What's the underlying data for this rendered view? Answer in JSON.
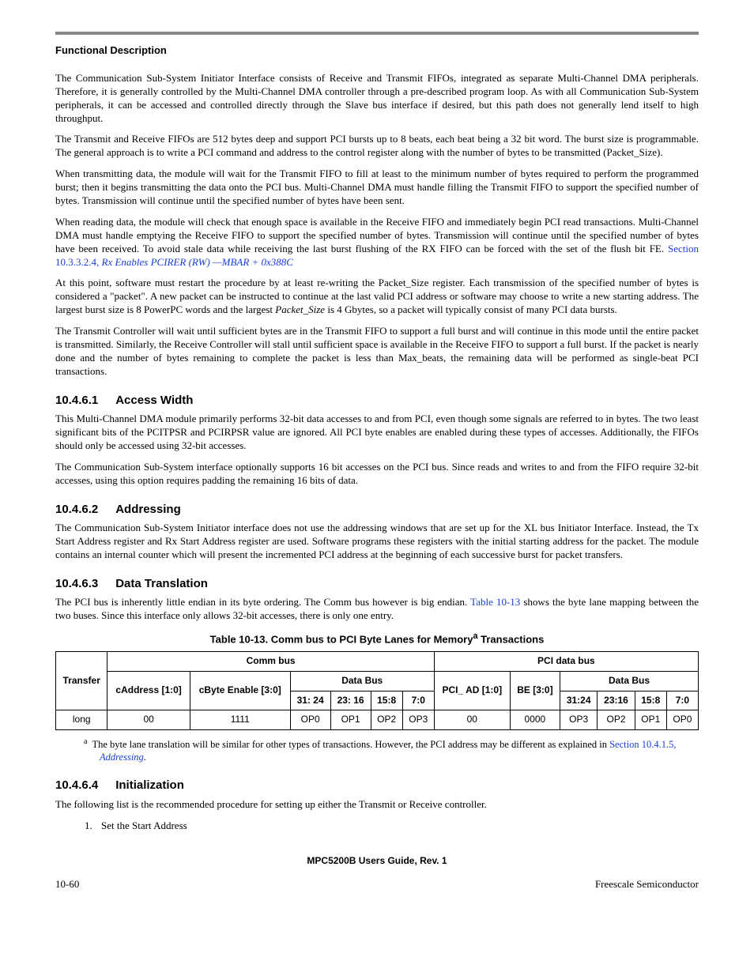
{
  "header": {
    "section_label": "Functional Description"
  },
  "chart_data": {
    "type": "table",
    "title": "Comm bus to PCI Byte Lanes for Memory Transactions",
    "groups": [
      "Transfer",
      "Comm bus",
      "PCI data bus"
    ],
    "columns": [
      "Transfer",
      "cAddress [1:0]",
      "cByte Enable [3:0]",
      "Data Bus 31:24",
      "Data Bus 23:16",
      "Data Bus 15:8",
      "Data Bus 7:0",
      "PCI_AD [1:0]",
      "BE [3:0]",
      "Data Bus 31:24",
      "Data Bus 23:16",
      "Data Bus 15:8",
      "Data Bus 7:0"
    ],
    "rows": [
      [
        "long",
        "00",
        "1111",
        "OP0",
        "OP1",
        "OP2",
        "OP3",
        "00",
        "0000",
        "OP3",
        "OP2",
        "OP1",
        "OP0"
      ]
    ]
  },
  "body": {
    "p1": "The Communication Sub-System Initiator Interface consists of Receive and Transmit FIFOs, integrated as separate Multi-Channel DMA peripherals. Therefore, it is generally controlled by the Multi-Channel DMA controller through a pre-described program loop. As with all Communication Sub-System peripherals, it can be accessed and controlled directly through the Slave bus interface if desired, but this path does not generally lend itself to high throughput.",
    "p2": "The Transmit and Receive FIFOs are 512 bytes deep and support PCI bursts up to 8 beats, each beat being a 32 bit word. The burst size is programmable. The general approach is to write a PCI command and address to the control register along with the number of bytes to be transmitted (Packet_Size).",
    "p3": "When transmitting data, the module will wait for the Transmit FIFO to fill at least to the minimum number of bytes required to perform the programmed burst; then it begins transmitting the data onto the PCI bus. Multi-Channel DMA must handle filling the Transmit FIFO to support the specified number of bytes. Transmission will continue until the specified number of bytes have been sent.",
    "p4a": "When reading data, the module will check that enough space is available in the Receive FIFO and immediately begin PCI read transactions. Multi-Channel DMA must handle emptying the Receive FIFO to support the specified number of bytes. Transmission will continue until the specified number of bytes have been received. To avoid stale data while receiving the last burst flushing of the RX FIFO can be forced with the set of the flush bit FE. ",
    "p4_link1": "Section 10.3.3.2.4, ",
    "p4_link2": "Rx Enables PCIRER (RW) —MBAR + 0x388C",
    "p5a": "At this point, software must restart the procedure by at least re-writing the Packet_Size register. Each transmission of the specified number of bytes is considered a \"packet\". A new packet can be instructed to continue at the last valid PCI address or software may choose to write a new starting address. The largest burst size is 8 PowerPC words and the largest ",
    "p5_em": "Packet_Size",
    "p5b": " is 4 Gbytes, so a packet will typically consist of many PCI data bursts.",
    "p6": "The Transmit Controller will wait until sufficient bytes are in the Transmit FIFO to support a full burst and will continue in this mode until the entire packet is transmitted. Similarly, the Receive Controller will stall until sufficient space is available in the Receive FIFO to support a full burst. If the packet is nearly done and the number of bytes remaining to complete the packet is less than Max_beats, the remaining data will be performed as single-beat PCI transactions."
  },
  "s1": {
    "num": "10.4.6.1",
    "title": "Access Width",
    "p1": "This Multi-Channel DMA module primarily performs 32-bit data accesses to and from PCI, even though some signals are referred to in bytes. The two least significant bits of the PCITPSR and PCIRPSR value are ignored. All PCI byte enables are enabled during these types of accesses. Additionally, the FIFOs should only be accessed using 32-bit accesses.",
    "p2": "The Communication Sub-System interface optionally supports 16 bit accesses on the PCI bus. Since reads and writes to and from the FIFO require 32-bit accesses, using this option requires padding the remaining 16 bits of data."
  },
  "s2": {
    "num": "10.4.6.2",
    "title": "Addressing",
    "p1": "The Communication Sub-System Initiator interface does not use the addressing windows that are set up for the XL bus Initiator Interface. Instead, the Tx Start Address register and Rx Start Address register are used. Software programs these registers with the initial starting address for the packet. The module contains an internal counter which will present the incremented PCI address at the beginning of each successive burst for packet transfers."
  },
  "s3": {
    "num": "10.4.6.3",
    "title": "Data Translation",
    "p1a": "The PCI bus is inherently little endian in its byte ordering. The Comm bus however is big endian. ",
    "p1_link": "Table 10-13",
    "p1b": " shows the byte lane mapping between the two buses. Since this interface only allows 32-bit accesses, there is only one entry."
  },
  "table": {
    "caption_a": "Table 10-13. Comm bus to PCI Byte Lanes for Memory",
    "caption_sup": "a",
    "caption_b": " Transactions",
    "h_transfer": "Transfer",
    "h_comm": "Comm bus",
    "h_pci": "PCI data bus",
    "h_caddr": "cAddress [1:0]",
    "h_cbyte": "cByte Enable [3:0]",
    "h_databus": "Data Bus",
    "h_31_24": "31: 24",
    "h_23_16": "23: 16",
    "h_15_8": "15:8",
    "h_7_0": "7:0",
    "h_pciad": "PCI_ AD [1:0]",
    "h_be": "BE [3:0]",
    "h2_31_24": "31:24",
    "h2_23_16": "23:16",
    "h2_15_8": "15:8",
    "h2_7_0": "7:0",
    "r1": {
      "c0": "long",
      "c1": "00",
      "c2": "1111",
      "c3": "OP0",
      "c4": "OP1",
      "c5": "OP2",
      "c6": "OP3",
      "c7": "00",
      "c8": "0000",
      "c9": "OP3",
      "c10": "OP2",
      "c11": "OP1",
      "c12": "OP0"
    }
  },
  "footnote": {
    "sup": "a",
    "text_a": "The byte lane translation will be similar for other types of transactions. However, the PCI address may be different as explained in ",
    "link1": "Section 10.4.1.5, ",
    "link2": "Addressing",
    "text_b": "."
  },
  "s4": {
    "num": "10.4.6.4",
    "title": "Initialization",
    "p1": "The following list is the recommended procedure for setting up either the Transmit or Receive controller.",
    "li1": "Set the Start Address"
  },
  "footer": {
    "center": "MPC5200B Users Guide, Rev. 1",
    "left": "10-60",
    "right": "Freescale Semiconductor"
  }
}
